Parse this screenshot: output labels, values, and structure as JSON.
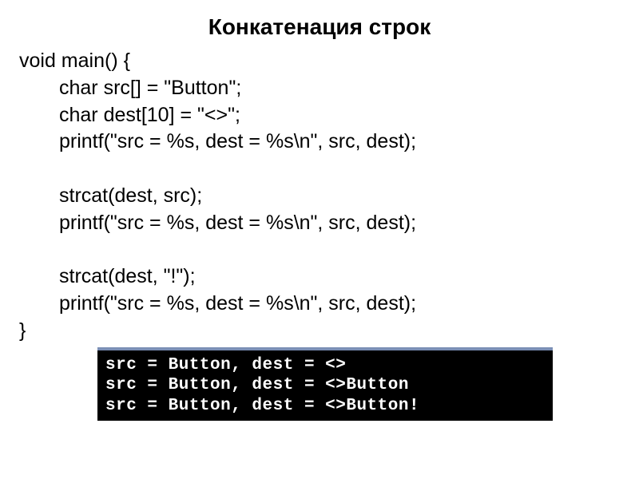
{
  "title": "Конкатенация строк",
  "code": {
    "l1": "void main() {",
    "l2": "char src[] = \"Button\";",
    "l3": "char dest[10] = \"<>\";",
    "l4": "printf(\"src = %s, dest = %s\\n\", src, dest);",
    "l5": "",
    "l6": "strcat(dest, src);",
    "l7": "printf(\"src = %s, dest = %s\\n\", src, dest);",
    "l8": "",
    "l9": "strcat(dest, \"!\");",
    "l10": "printf(\"src = %s, dest = %s\\n\", src, dest);",
    "l11": "}"
  },
  "console": {
    "out1": "src = Button, dest = <>",
    "out2": "src = Button, dest = <>Button",
    "out3": "src = Button, dest = <>Button!"
  }
}
